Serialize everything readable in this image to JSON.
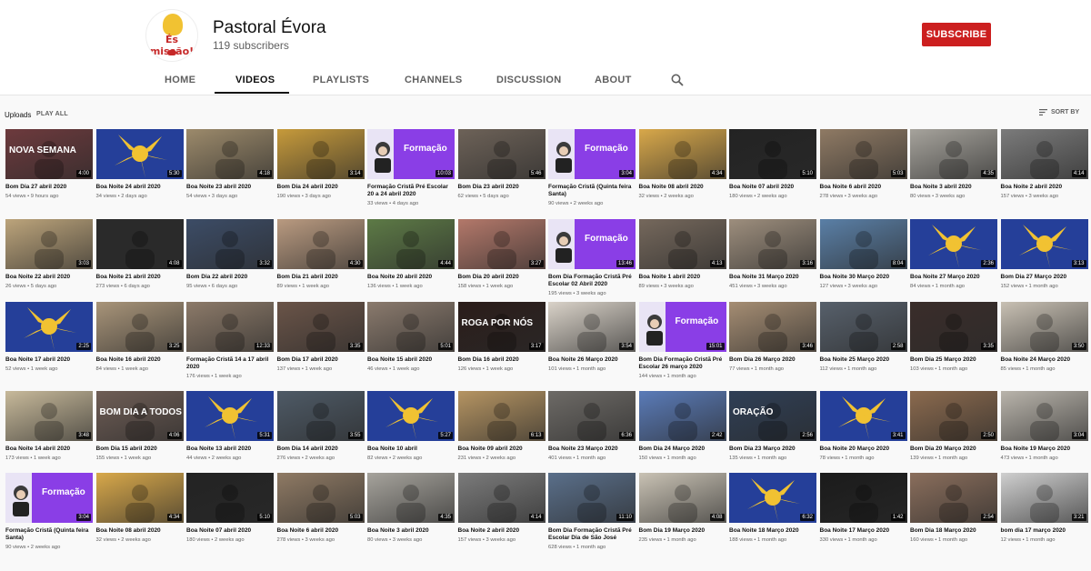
{
  "channel": {
    "name": "Pastoral Évora",
    "subscribers": "119 subscribers",
    "logo_text": "És missão!"
  },
  "subscribe_label": "SUBSCRIBE",
  "tabs": [
    "HOME",
    "VIDEOS",
    "PLAYLISTS",
    "CHANNELS",
    "DISCUSSION",
    "ABOUT"
  ],
  "active_tab": "VIDEOS",
  "uploads_label": "Uploads",
  "play_all": "PLAY ALL",
  "sort_by": "SORT BY",
  "colors": {
    "subscribe_red": "#cc1f1f",
    "brand_blue": "#253f99",
    "brand_yellow": "#f1c232",
    "brand_purple": "#8a3ee6"
  },
  "videos": [
    [
      {
        "title": "Bom Dia 27 abril 2020",
        "meta": "54 views • 9 hours ago",
        "dur": "4:00",
        "kind": "photo",
        "bg": "#6d3a3d",
        "label": "NOVA SEMANA"
      },
      {
        "title": "Boa Noite 24 abril 2020",
        "meta": "34 views • 2 days ago",
        "dur": "5:30",
        "kind": "logo"
      },
      {
        "title": "Boa Noite 23 abril 2020",
        "meta": "54 views • 3 days ago",
        "dur": "4:18",
        "kind": "photo",
        "bg": "#9c8a6b"
      },
      {
        "title": "Bom Dia 24 abril 2020",
        "meta": "190 views • 3 days ago",
        "dur": "3:14",
        "kind": "photo",
        "bg": "#c69a3b"
      },
      {
        "title": "Formação Cristã Pré Escolar 20 a 24 abril 2020",
        "meta": "33 views • 4 days ago",
        "dur": "10:03",
        "kind": "purple",
        "label": "Formação"
      },
      {
        "title": "Bom Dia 23 abril 2020",
        "meta": "62 views • 5 days ago",
        "dur": "5:46",
        "kind": "photo",
        "bg": "#6d6258"
      },
      {
        "title": "Formação Cristã (Quinta feira Santa)",
        "meta": "90 views • 2 weeks ago",
        "dur": "3:04",
        "kind": "purple",
        "label": "Formação"
      },
      {
        "title": "Boa Noite 08 abril 2020",
        "meta": "32 views • 2 weeks ago",
        "dur": "4:34",
        "kind": "photo",
        "bg": "#d8a84a"
      },
      {
        "title": "Boa Noite 07 abril 2020",
        "meta": "180 views • 2 weeks ago",
        "dur": "5:10",
        "kind": "photo",
        "bg": "#232323"
      },
      {
        "title": "Boa Noite 6 abril 2020",
        "meta": "278 views • 3 weeks ago",
        "dur": "5:03",
        "kind": "photo",
        "bg": "#8f7a64"
      },
      {
        "title": "Boa Noite 3 abril 2020",
        "meta": "80 views • 3 weeks ago",
        "dur": "4:35",
        "kind": "photo",
        "bg": "#a6a39c"
      },
      {
        "title": "Boa Noite 2 abril 2020",
        "meta": "157 views • 3 weeks ago",
        "dur": "4:14",
        "kind": "photo",
        "bg": "#7b7b7b"
      }
    ],
    [
      {
        "title": "Boa Noite 22 abril 2020",
        "meta": "26 views • 5 days ago",
        "dur": "3:03",
        "kind": "photo",
        "bg": "#bca47b"
      },
      {
        "title": "Boa Noite 21 abril 2020",
        "meta": "273 views • 6 days ago",
        "dur": "4:08",
        "kind": "photo",
        "bg": "#2a2a2a"
      },
      {
        "title": "Bom Dia 22 abril 2020",
        "meta": "95 views • 6 days ago",
        "dur": "3:32",
        "kind": "photo",
        "bg": "#3c4c66"
      },
      {
        "title": "Bom Dia 21 abril 2020",
        "meta": "89 views • 1 week ago",
        "dur": "4:30",
        "kind": "photo",
        "bg": "#b99a80"
      },
      {
        "title": "Boa Noite 20 abril 2020",
        "meta": "136 views • 1 week ago",
        "dur": "4:44",
        "kind": "photo",
        "bg": "#5d7a46"
      },
      {
        "title": "Bom Dia 20 abril 2020",
        "meta": "158 views • 1 week ago",
        "dur": "3:27",
        "kind": "photo",
        "bg": "#b3786a"
      },
      {
        "title": "Bom Dia Formação Cristã Pré Escolar 02 Abril 2020",
        "meta": "195 views • 3 weeks ago",
        "dur": "13:46",
        "kind": "purple",
        "label": "Formação"
      },
      {
        "title": "Boa Noite 1 abril 2020",
        "meta": "89 views • 3 weeks ago",
        "dur": "4:13",
        "kind": "photo",
        "bg": "#75685c"
      },
      {
        "title": "Boa Noite 31 Março 2020",
        "meta": "451 views • 3 weeks ago",
        "dur": "3:16",
        "kind": "photo",
        "bg": "#9d8e7d"
      },
      {
        "title": "Boa Noite 30 Março 2020",
        "meta": "127 views • 3 weeks ago",
        "dur": "8:04",
        "kind": "photo",
        "bg": "#5a7fa6"
      },
      {
        "title": "Boa Noite 27 Março 2020",
        "meta": "84 views • 1 month ago",
        "dur": "2:36",
        "kind": "logo"
      },
      {
        "title": "Bom Dia 27 Março 2020",
        "meta": "152 views • 1 month ago",
        "dur": "3:13",
        "kind": "logo"
      }
    ],
    [
      {
        "title": "Boa Noite 17 abril 2020",
        "meta": "52 views • 1 week ago",
        "dur": "2:25",
        "kind": "logo"
      },
      {
        "title": "Boa Noite 16 abril 2020",
        "meta": "84 views • 1 week ago",
        "dur": "3:25",
        "kind": "photo",
        "bg": "#a89479"
      },
      {
        "title": "Formação Cristã 14 a 17 abril 2020",
        "meta": "176 views • 1 week ago",
        "dur": "12:33",
        "kind": "photo",
        "bg": "#8c7a69"
      },
      {
        "title": "Bom Dia 17 abril 2020",
        "meta": "137 views • 1 week ago",
        "dur": "3:35",
        "kind": "photo",
        "bg": "#6a5448"
      },
      {
        "title": "Boa Noite 15 abril 2020",
        "meta": "46 views • 1 week ago",
        "dur": "5:01",
        "kind": "photo",
        "bg": "#8a7a6d"
      },
      {
        "title": "Bom Dia 16 abril 2020",
        "meta": "126 views • 1 week ago",
        "dur": "3:17",
        "kind": "photo",
        "bg": "#2b1d1a",
        "label": "ROGA POR NÓS"
      },
      {
        "title": "Boa Noite 26 Março 2020",
        "meta": "101 views • 1 month ago",
        "dur": "3:54",
        "kind": "photo",
        "bg": "#d9d2c8"
      },
      {
        "title": "Bom Dia Formação Cristã Pré Escolar 26 março 2020",
        "meta": "144 views • 1 month ago",
        "dur": "15:01",
        "kind": "purple",
        "label": "Formação"
      },
      {
        "title": "Bom Dia 26 Março 2020",
        "meta": "77 views • 1 month ago",
        "dur": "3:46",
        "kind": "photo",
        "bg": "#a58d73"
      },
      {
        "title": "Boa Noite 25 Março 2020",
        "meta": "112 views • 1 month ago",
        "dur": "2:58",
        "kind": "photo",
        "bg": "#57606b"
      },
      {
        "title": "Bom Dia 25 Março 2020",
        "meta": "103 views • 1 month ago",
        "dur": "3:35",
        "kind": "photo",
        "bg": "#3a2d2a"
      },
      {
        "title": "Boa Noite 24 Março 2020",
        "meta": "85 views • 1 month ago",
        "dur": "3:50",
        "kind": "photo",
        "bg": "#c8c0b3"
      }
    ],
    [
      {
        "title": "Boa Noite 14 abril 2020",
        "meta": "173 views • 1 week ago",
        "dur": "3:48",
        "kind": "photo",
        "bg": "#c7b99a"
      },
      {
        "title": "Bom Dia 15 abril 2020",
        "meta": "155 views • 1 week ago",
        "dur": "4:06",
        "kind": "photo",
        "bg": "#6e5d55",
        "label": "BOM DIA A TODOS"
      },
      {
        "title": "Boa Noite 13 abril 2020",
        "meta": "44 views • 2 weeks ago",
        "dur": "5:31",
        "kind": "logo"
      },
      {
        "title": "Bom Dia 14 abril 2020",
        "meta": "276 views • 2 weeks ago",
        "dur": "3:55",
        "kind": "photo",
        "bg": "#4e5a66"
      },
      {
        "title": "Boa Noite 10 abril",
        "meta": "82 views • 2 weeks ago",
        "dur": "5:27",
        "kind": "logo"
      },
      {
        "title": "Boa Noite 09 abril 2020",
        "meta": "231 views • 2 weeks ago",
        "dur": "6:13",
        "kind": "photo",
        "bg": "#b59462"
      },
      {
        "title": "Boa Noite 23 Março 2020",
        "meta": "401 views • 1 month ago",
        "dur": "6:36",
        "kind": "photo",
        "bg": "#6d6a66"
      },
      {
        "title": "Bom Dia 24 Março 2020",
        "meta": "150 views • 1 month ago",
        "dur": "2:42",
        "kind": "photo",
        "bg": "#5a7bb8"
      },
      {
        "title": "Bom Dia 23 Março 2020",
        "meta": "135 views • 1 month ago",
        "dur": "2:56",
        "kind": "photo",
        "bg": "#2f3f56",
        "label": "ORAÇÃO"
      },
      {
        "title": "Boa Noite 20 Março 2020",
        "meta": "78 views • 1 month ago",
        "dur": "3:41",
        "kind": "logo"
      },
      {
        "title": "Bom Dia 20 Março 2020",
        "meta": "139 views • 1 month ago",
        "dur": "2:50",
        "kind": "photo",
        "bg": "#8b6a4e"
      },
      {
        "title": "Boa Noite 19 Março 2020",
        "meta": "473 views • 1 month ago",
        "dur": "3:04",
        "kind": "photo",
        "bg": "#b9b4ab"
      }
    ],
    [
      {
        "title": "Formação Cristã (Quinta feira Santa)",
        "meta": "90 views • 2 weeks ago",
        "dur": "3:04",
        "kind": "purple",
        "label": "Formação"
      },
      {
        "title": "Boa Noite 08 abril 2020",
        "meta": "32 views • 2 weeks ago",
        "dur": "4:34",
        "kind": "photo",
        "bg": "#d8a84a"
      },
      {
        "title": "Boa Noite 07 abril 2020",
        "meta": "180 views • 2 weeks ago",
        "dur": "5:10",
        "kind": "photo",
        "bg": "#232323"
      },
      {
        "title": "Boa Noite 6 abril 2020",
        "meta": "278 views • 3 weeks ago",
        "dur": "5:03",
        "kind": "photo",
        "bg": "#8f7a64"
      },
      {
        "title": "Boa Noite 3 abril 2020",
        "meta": "80 views • 3 weeks ago",
        "dur": "4:35",
        "kind": "photo",
        "bg": "#a6a39c"
      },
      {
        "title": "Boa Noite 2 abril 2020",
        "meta": "157 views • 3 weeks ago",
        "dur": "4:14",
        "kind": "photo",
        "bg": "#7b7b7b"
      },
      {
        "title": "Bom Dia Formação Cristã Pré Escolar Dia de São José",
        "meta": "628 views • 1 month ago",
        "dur": "11:10",
        "kind": "photo",
        "bg": "#5a6f8a"
      },
      {
        "title": "Bom Dia 19 Março 2020",
        "meta": "235 views • 1 month ago",
        "dur": "4:08",
        "kind": "photo",
        "bg": "#c9c2b4"
      },
      {
        "title": "Boa Noite 18 Março 2020",
        "meta": "188 views • 1 month ago",
        "dur": "6:32",
        "kind": "logo"
      },
      {
        "title": "Boa Noite 17 Março 2020",
        "meta": "330 views • 1 month ago",
        "dur": "1:42",
        "kind": "photo",
        "bg": "#1b1b1b"
      },
      {
        "title": "Bom Dia 18 Março 2020",
        "meta": "160 views • 1 month ago",
        "dur": "2:54",
        "kind": "photo",
        "bg": "#8a6e5c"
      },
      {
        "title": "bom dia 17 março 2020",
        "meta": "12 views • 1 month ago",
        "dur": "3:21",
        "kind": "photo",
        "bg": "#cfcfcf"
      }
    ]
  ]
}
